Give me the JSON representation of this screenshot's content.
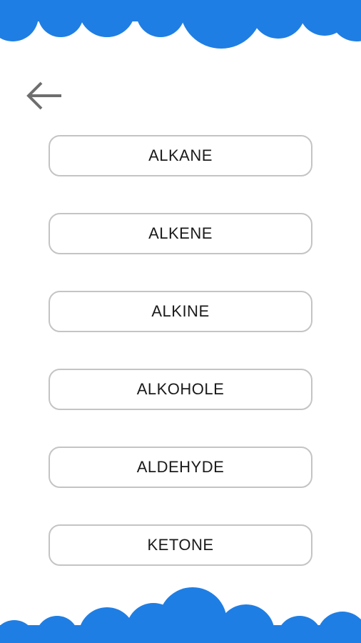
{
  "theme": {
    "accent": "#1f7ee3",
    "border": "#c4c4c4",
    "back_arrow": "#6e6e6e"
  },
  "header": {
    "back_icon": "arrow-left-icon"
  },
  "menu": {
    "items": [
      {
        "label": "ALKANE"
      },
      {
        "label": "ALKENE"
      },
      {
        "label": "ALKINE"
      },
      {
        "label": "ALKOHOLE"
      },
      {
        "label": "ALDEHYDE"
      },
      {
        "label": "KETONE"
      }
    ]
  }
}
